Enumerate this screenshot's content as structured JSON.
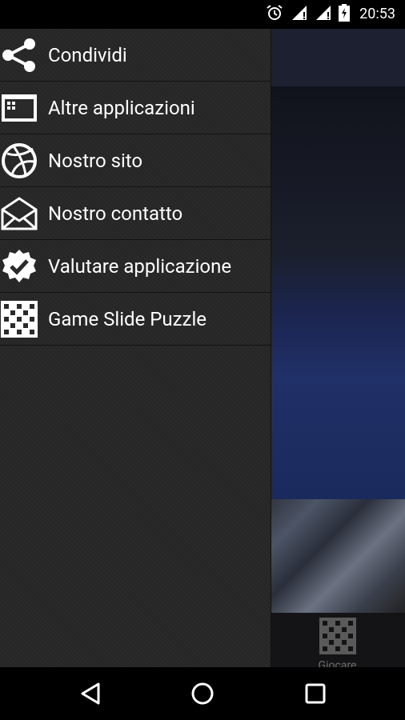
{
  "status": {
    "time": "20:53"
  },
  "drawer": {
    "items": [
      {
        "label": "Condividi",
        "icon": "share-icon"
      },
      {
        "label": "Altre applicazioni",
        "icon": "apps-window-icon"
      },
      {
        "label": "Nostro sito",
        "icon": "dribbble-ball-icon"
      },
      {
        "label": "Nostro contatto",
        "icon": "mail-open-icon"
      },
      {
        "label": "Valutare applicazione",
        "icon": "check-badge-icon"
      },
      {
        "label": "Game Slide Puzzle",
        "icon": "puzzle-grid-icon"
      }
    ]
  },
  "bottom_tab": {
    "label": "Giocare",
    "icon": "puzzle-grid-icon"
  },
  "nav": {
    "back": "back-icon",
    "home": "home-icon",
    "recents": "recents-icon"
  }
}
